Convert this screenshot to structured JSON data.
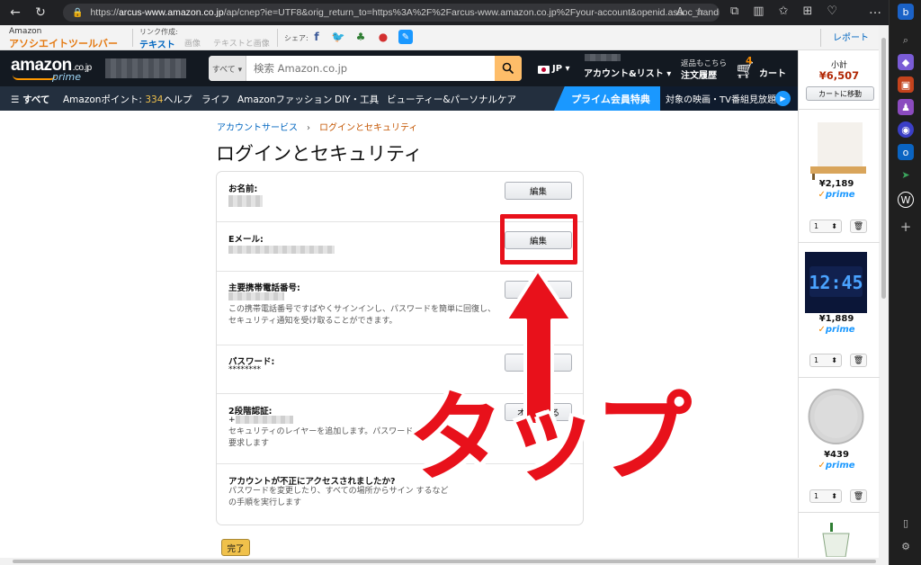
{
  "browser": {
    "url_host": "arcus-www.amazon.co.jp",
    "url_rest": "/ap/cnep?ie=UTF8&orig_return_to=https%3A%2F%2Farcus-www.amazon.co.jp%2Fyour-account&openid.assoc_handle...",
    "url_scheme": "https://"
  },
  "associate_toolbar": {
    "brand_top": "Amazon",
    "brand_bottom": "アソシエイトツールバー",
    "link_create_label": "リンク作成:",
    "link_text": "テキスト",
    "link_image": "画像",
    "link_text_image": "テキストと画像",
    "share_label": "シェア:",
    "report": "レポート"
  },
  "header": {
    "logo": "amazon",
    "logo_suffix": ".co.jp",
    "prime": "prime",
    "search_category": "すべて ▾",
    "search_placeholder": "検索 Amazon.co.jp",
    "lang": "JP ▾",
    "account_list": "アカウント&リスト ▾",
    "orders_top": "返品もこちら",
    "orders_bottom": "注文履歴",
    "cart_count": "4",
    "cart_label": "カート"
  },
  "subnav": {
    "all": "すべて",
    "points_label": "Amazonポイント:",
    "points_value": "334",
    "help": "ヘルプ",
    "life": "ライフ",
    "fashion": "Amazonファッション",
    "diy": "DIY・工具",
    "beauty": "ビューティー&パーソナルケア",
    "prime_benefit": "プライム会員特典",
    "prime_video": "対象の映画・TV番組見放題"
  },
  "breadcrumb": {
    "account_service": "アカウントサービス",
    "separator": "›",
    "current": "ログインとセキュリティ"
  },
  "page_title": "ログインとセキュリティ",
  "rows": {
    "name": {
      "label": "お名前:",
      "button": "編集"
    },
    "email": {
      "label": "Eメール:",
      "button": "編集"
    },
    "phone": {
      "label": "主要携帯電話番号:",
      "desc1": "この携帯電話番号ですばやくサインインし、パスワードを簡単に回復し、",
      "desc2": "セキュリティ通知を受け取ることができます。",
      "button": "編集"
    },
    "password": {
      "label": "パスワード:",
      "value": "********",
      "button": "編集"
    },
    "twostep": {
      "label": "2段階認証:",
      "value": "+",
      "desc1": "セキュリティのレイヤーを追加します。パスワードに",
      "desc2": "要求します",
      "button": "オンにする"
    },
    "compromised": {
      "label": "アカウントが不正にアクセスされましたか?",
      "desc1": "パスワードを変更したり、すべての場所からサイン                          するなど",
      "desc2": "の手順を実行します"
    }
  },
  "done_button": "完了",
  "cart_sidebar": {
    "subtotal_label": "小計",
    "subtotal": "¥6,507",
    "goto_cart": "カートに移動",
    "items": [
      {
        "price": "¥2,189",
        "prime": "prime",
        "qty": "1"
      },
      {
        "price": "¥1,889",
        "prime": "prime",
        "qty": "1"
      },
      {
        "price": "¥439",
        "prime": "prime",
        "qty": "1"
      }
    ]
  },
  "annotation": {
    "tap_text": "タップ",
    "color": "#e8111b"
  },
  "colors": {
    "amazon_dark": "#131921",
    "amazon_subnav": "#232f3e",
    "amazon_orange": "#ff9900",
    "link_blue": "#0066c0",
    "price_red": "#b12704",
    "prime_blue": "#1a98ff"
  }
}
